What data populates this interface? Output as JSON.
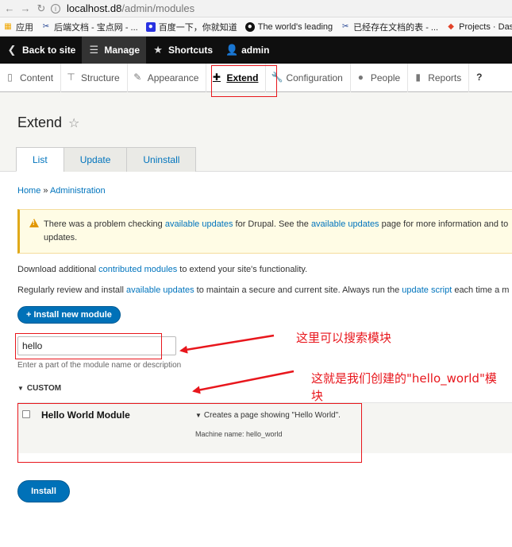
{
  "browser": {
    "url_host": "localhost.d8",
    "url_path": "/admin/modules",
    "bookmarks": [
      {
        "icon": "apps-grid-icon",
        "color": "#f1a700",
        "label": "应用"
      },
      {
        "icon": "scissors-icon",
        "color": "#1a3c8f",
        "label": "后端文档 - 宝点网 - ..."
      },
      {
        "icon": "paw-icon",
        "color": "#2932e1",
        "label": "百度一下，你就知道"
      },
      {
        "icon": "github-icon",
        "color": "#111111",
        "label": "The world's leading"
      },
      {
        "icon": "scissors-icon",
        "color": "#1a3c8f",
        "label": "已经存在文档的表 - ..."
      },
      {
        "icon": "gitlab-icon",
        "color": "#e24329",
        "label": "Projects · Dashboar"
      }
    ]
  },
  "toolbar": {
    "back_to_site": "Back to site",
    "manage": "Manage",
    "shortcuts": "Shortcuts",
    "user": "admin"
  },
  "tray": {
    "items": [
      "Content",
      "Structure",
      "Appearance",
      "Extend",
      "Configuration",
      "People",
      "Reports"
    ]
  },
  "page": {
    "title": "Extend",
    "tabs": [
      "List",
      "Update",
      "Uninstall"
    ],
    "breadcrumb": {
      "home": "Home",
      "sep": " » ",
      "admin": "Administration"
    }
  },
  "warning": {
    "t1": "There was a problem checking ",
    "link1": "available updates",
    "t2": " for Drupal. See the ",
    "link2": "available updates",
    "t3": " page for more information and to",
    "t4": "updates."
  },
  "para1": {
    "t1": "Download additional ",
    "link": "contributed modules",
    "t2": " to extend your site's functionality."
  },
  "para2": {
    "t1": "Regularly review and install ",
    "link1": "available updates",
    "t2": " to maintain a secure and current site. Always run the ",
    "link2": "update script",
    "t3": " each time a m"
  },
  "buttons": {
    "install_new": "+ Install new module",
    "install": "Install"
  },
  "filter": {
    "value": "hello",
    "description": "Enter a part of the module name or description"
  },
  "package": {
    "name": "CUSTOM"
  },
  "module": {
    "name": "Hello World Module",
    "description": "Creates a page showing \"Hello World\".",
    "machine_name": "Machine name: hello_world"
  },
  "annotations": {
    "search_note": "这里可以搜索模块",
    "module_note_line1": "这就是我们创建的\"hello_world\"模",
    "module_note_line2": "块",
    "color": "#e8161c"
  }
}
